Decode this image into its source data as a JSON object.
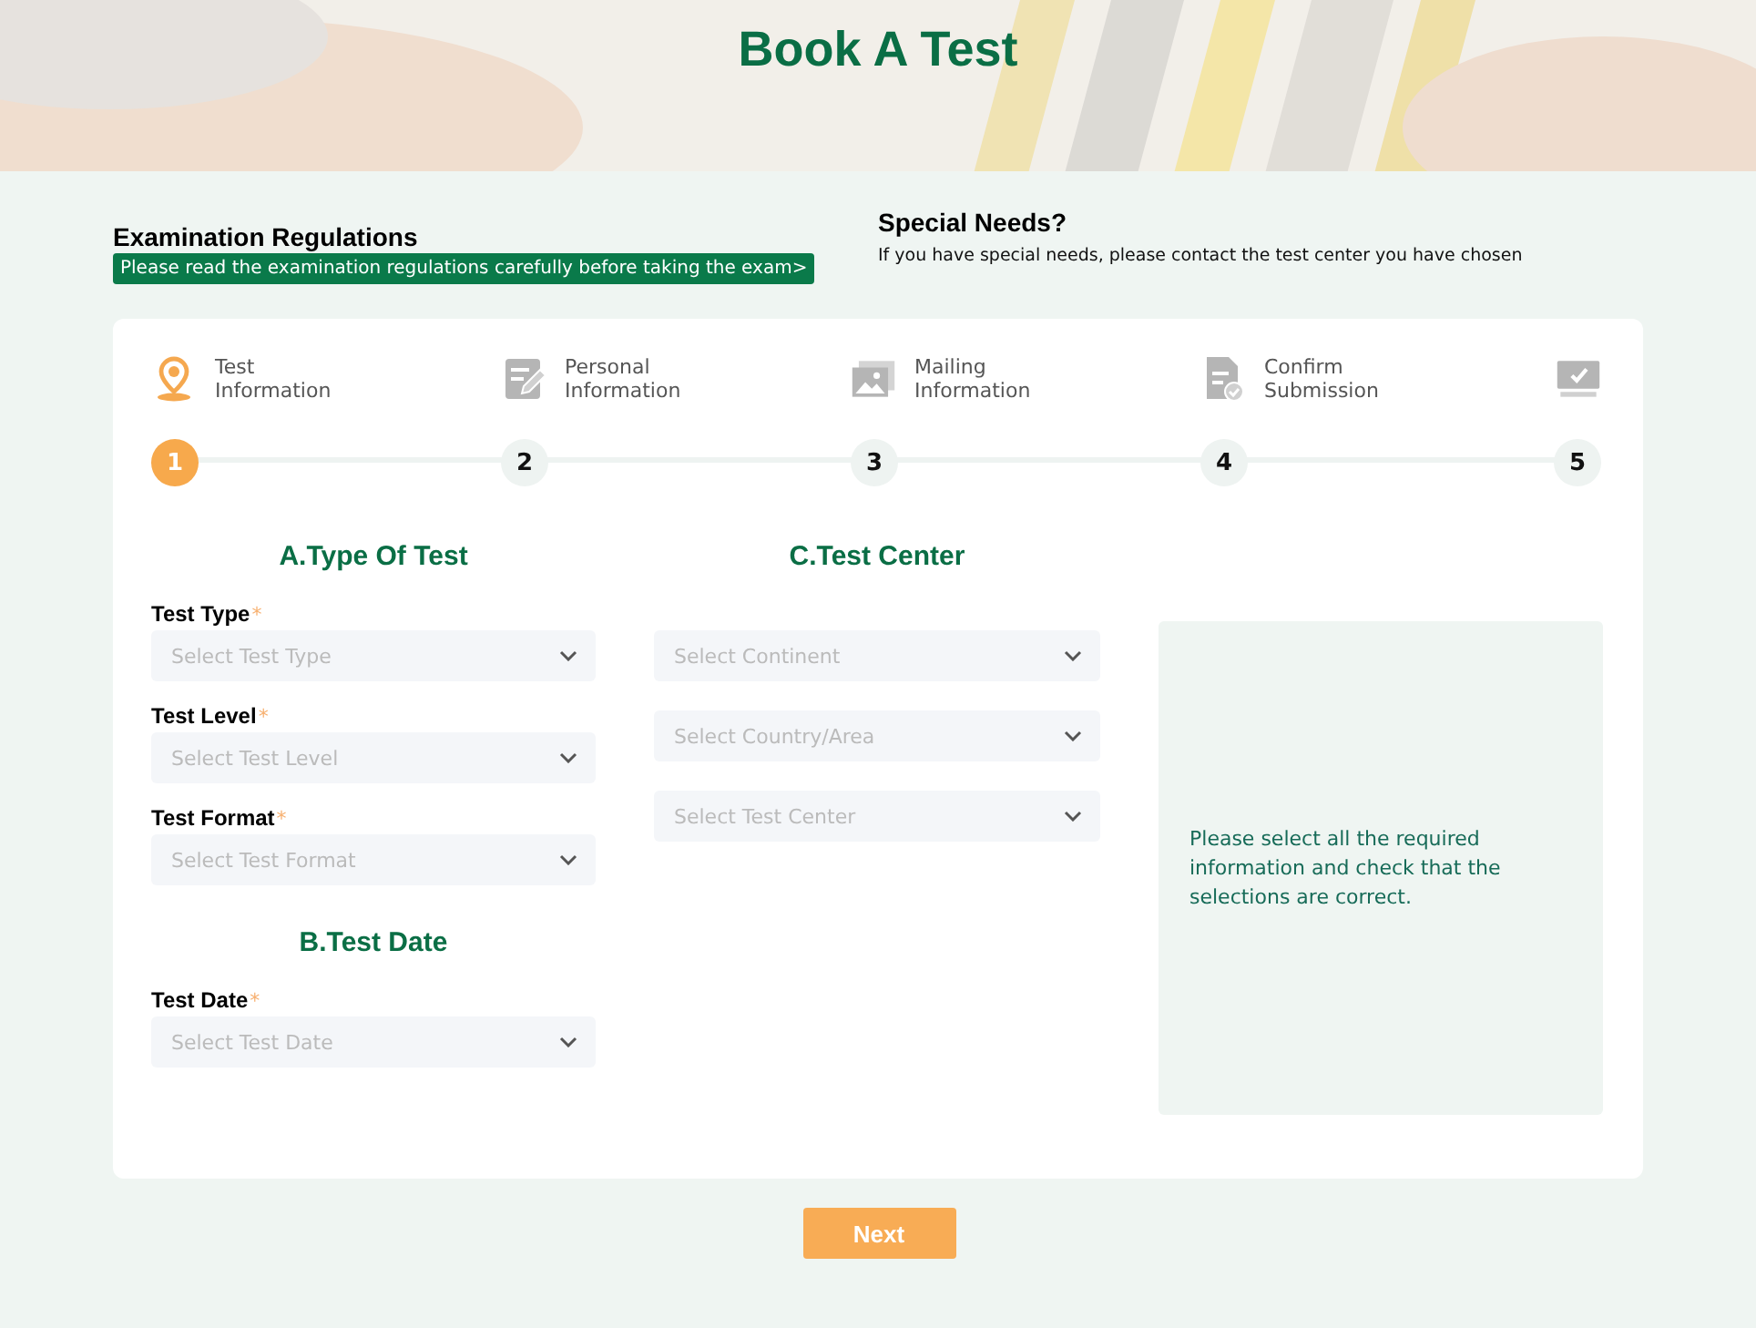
{
  "banner": {
    "title": "Book A Test"
  },
  "notices": [
    {
      "kind": "link",
      "title": "Examination Regulations",
      "text": "Please read the examination regulations carefully before taking the exam>"
    },
    {
      "kind": "plain",
      "title": "Special Needs?",
      "text": "If you have special needs, please contact the test center you have chosen"
    }
  ],
  "steps": [
    {
      "label": "Test Information",
      "number": "1",
      "selected": true
    },
    {
      "label": "Personal Information",
      "number": "2",
      "selected": false
    },
    {
      "label": "Mailing Information",
      "number": "3",
      "selected": false
    },
    {
      "label": "Confirm Submission",
      "number": "4",
      "selected": false
    },
    {
      "number": "5",
      "selected": false
    }
  ],
  "columns": [
    {
      "sections": [
        {
          "title": "A.Type Of Test",
          "fields": [
            {
              "label": "Test Type",
              "mark": "*",
              "placeholder": "Select Test Type"
            },
            {
              "label": "Test Level",
              "mark": "*",
              "placeholder": "Select Test Level"
            },
            {
              "label": "Test Format",
              "mark": "*",
              "placeholder": "Select Test Format"
            }
          ]
        },
        {
          "title": "B.Test Date",
          "fields": [
            {
              "label": "Test Date",
              "mark": "*",
              "placeholder": "Select Test Date"
            }
          ]
        }
      ]
    },
    {
      "sections": [
        {
          "title": "C.Test Center",
          "fields": [
            {
              "placeholder": "Select Continent"
            },
            {
              "placeholder": "Select Country/Area"
            },
            {
              "placeholder": "Select Test Center"
            }
          ]
        }
      ]
    }
  ],
  "summary": {
    "text": "Please select all the required information and check that the selections are correct."
  },
  "next_button": "Next"
}
